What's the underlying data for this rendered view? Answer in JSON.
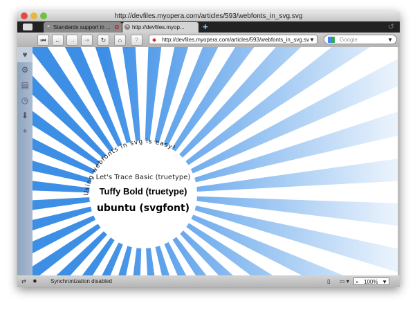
{
  "window": {
    "title": "http://devfiles.myopera.com/articles/593/webfonts_in_svg.svg"
  },
  "tabs": [
    {
      "label": "Standards support in ..."
    },
    {
      "label": "http://devfiles.myop..."
    }
  ],
  "address": {
    "url": "http://devfiles.myopera.com/articles/593/webfonts_in_svg.sv"
  },
  "search": {
    "placeholder": "Google"
  },
  "content": {
    "arc_text": "Using webfonts in svg is easy!",
    "line1": "Let's Trace Basic (truetype)",
    "line2": "Tuffy Bold (truetype)",
    "line3": "ubuntu (svgfont)",
    "ray_color": "#3d8fe6"
  },
  "status": {
    "text": "Synchronization disabled",
    "zoom": "100%"
  }
}
